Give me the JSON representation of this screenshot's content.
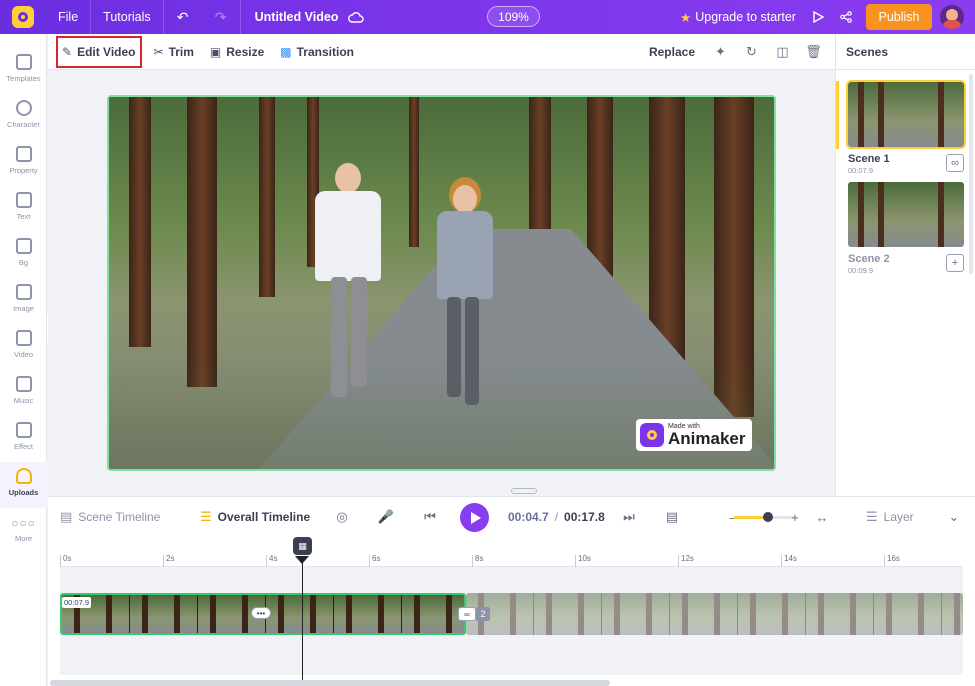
{
  "topbar": {
    "file": "File",
    "tutorials": "Tutorials",
    "title": "Untitled Video",
    "zoom": "109%",
    "upgrade": "Upgrade to starter",
    "publish": "Publish",
    "colors": {
      "bar": "#7b34ea",
      "publish": "#f7931e",
      "accent": "#ffcf3a"
    }
  },
  "sidebar": {
    "items": [
      {
        "label": "Templates",
        "icon": "templates-icon"
      },
      {
        "label": "Character",
        "icon": "character-icon"
      },
      {
        "label": "Property",
        "icon": "property-icon"
      },
      {
        "label": "Text",
        "icon": "text-icon"
      },
      {
        "label": "Bg",
        "icon": "background-icon"
      },
      {
        "label": "Image",
        "icon": "image-icon"
      },
      {
        "label": "Video",
        "icon": "video-icon"
      },
      {
        "label": "Music",
        "icon": "music-icon"
      },
      {
        "label": "Effect",
        "icon": "effect-icon"
      },
      {
        "label": "Uploads",
        "icon": "uploads-icon",
        "active": true
      },
      {
        "label": "More",
        "icon": "more-icon"
      }
    ]
  },
  "edit_toolbar": {
    "edit_video": "Edit Video",
    "trim": "Trim",
    "resize": "Resize",
    "transition": "Transition",
    "replace": "Replace"
  },
  "watermark": {
    "small": "Made with",
    "big": "Animaker"
  },
  "scenes": {
    "title": "Scenes",
    "list": [
      {
        "name": "Scene 1",
        "duration": "00:07.9",
        "active": true
      },
      {
        "name": "Scene 2",
        "duration": "00:09.9",
        "active": false
      }
    ]
  },
  "timeline": {
    "scene_timeline": "Scene Timeline",
    "overall_timeline": "Overall Timeline",
    "current_time": "00:04.7",
    "separator": "/",
    "total_time": "00:17.8",
    "layer": "Layer",
    "zoom_level": 0.55,
    "ruler_ticks": [
      "0s",
      "2s",
      "4s",
      "6s",
      "8s",
      "10s",
      "12s",
      "14s",
      "16s"
    ],
    "clip_time": "00:07.9",
    "scene2_badge": "2"
  }
}
